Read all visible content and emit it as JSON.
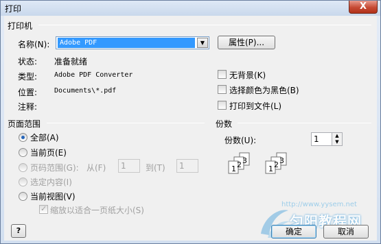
{
  "window": {
    "title": "打印",
    "close_glyph": "X"
  },
  "printer": {
    "group_label": "打印机",
    "name_label": "名称(N):",
    "name_value": "Adobe PDF",
    "properties_button": "属性(P)...",
    "status_label": "状态:",
    "status_value": "准备就绪",
    "type_label": "类型:",
    "type_value": "Adobe PDF Converter",
    "location_label": "位置:",
    "location_value": "Documents\\*.pdf",
    "comment_label": "注释:",
    "no_background": "无背景(K)",
    "black_selection": "选择颜色为黑色(B)",
    "print_to_file": "打印到文件(L)"
  },
  "page_range": {
    "group_label": "页面范围",
    "all": "全部(A)",
    "current_page": "当前页(E)",
    "page_range": "页码范围(G):",
    "from": "从(F)",
    "from_value": "1",
    "to": "到(T)",
    "to_value": "1",
    "selected_content": "选定内容(I)",
    "current_view": "当前视图(V)",
    "fit_page": "缩放以适合一页纸大小(S)",
    "selected_option": "all"
  },
  "copies": {
    "group_label": "份数",
    "copies_label": "份数(U):",
    "copies_value": "1",
    "collate_left_numbers": [
      "1",
      "2",
      "3"
    ],
    "collate_right_numbers": [
      "1",
      "2",
      "3"
    ]
  },
  "buttons": {
    "ok": "确定",
    "cancel": "取消",
    "help": "?"
  },
  "watermark": {
    "url": "http://www.yysem.net",
    "brand": "匀阳教程网"
  },
  "colors": {
    "accent": "#3399ff",
    "close": "#c64a34"
  }
}
